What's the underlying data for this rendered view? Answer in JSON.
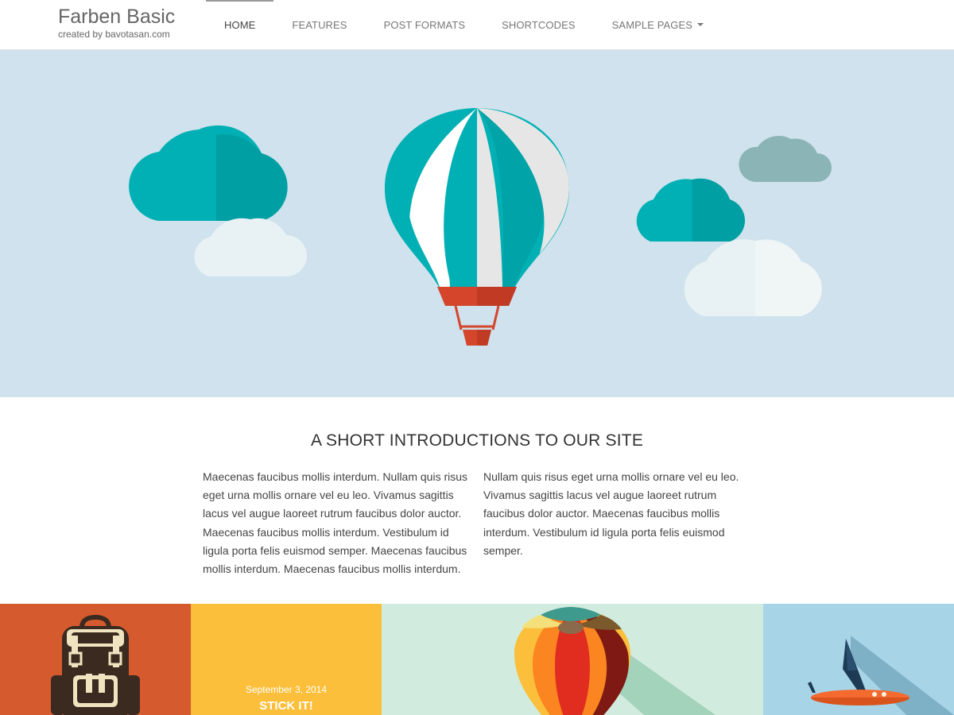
{
  "site": {
    "title": "Farben Basic",
    "tagline": "created by bavotasan.com"
  },
  "nav": {
    "items": [
      {
        "label": "HOME",
        "active": true
      },
      {
        "label": "FEATURES"
      },
      {
        "label": "POST FORMATS"
      },
      {
        "label": "SHORTCODES"
      },
      {
        "label": "SAMPLE PAGES",
        "has_dropdown": true
      }
    ]
  },
  "intro": {
    "title": "A SHORT INTRODUCTIONS TO OUR SITE",
    "left": "Maecenas faucibus mollis interdum. Nullam quis risus eget urna mollis ornare vel eu leo. Vivamus sagittis lacus vel augue laoreet rutrum faucibus dolor auctor. Maecenas faucibus mollis interdum. Vestibulum id ligula porta felis euismod semper. Maecenas faucibus mollis interdum. Maecenas faucibus mollis interdum.",
    "right": "Nullam quis risus eget urna mollis ornare vel eu leo. Vivamus sagittis lacus vel augue laoreet rutrum faucibus dolor auctor. Maecenas faucibus mollis interdum. Vestibulum id ligula porta felis euismod semper."
  },
  "tiles": [
    {
      "image": "backpack-icon",
      "color": "#d55b2e"
    },
    {
      "date": "September 3, 2014",
      "title": "STICK IT!",
      "color": "#fcbf3b"
    },
    {
      "image": "hot-air-balloon-icon",
      "color": "#d1ecde"
    },
    {
      "image": "airplane-icon",
      "color": "#a8d4e7"
    }
  ],
  "colors": {
    "hero_bg": "#cfe2ed",
    "teal": "#00b0b4",
    "balloon_basket": "#d4452c"
  }
}
